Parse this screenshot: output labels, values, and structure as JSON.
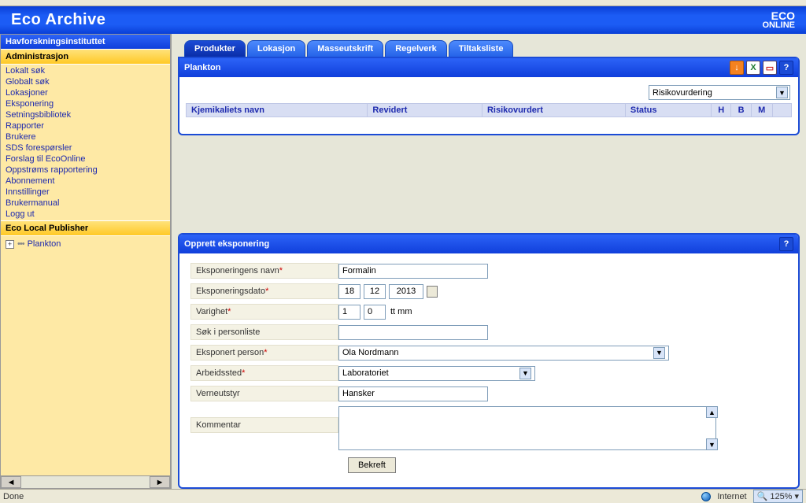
{
  "header": {
    "title": "Eco Archive",
    "logo_top": "ECO",
    "logo_bottom": "ONLINE"
  },
  "sidebar": {
    "org_header": "Havforskningsinstituttet",
    "section1_title": "Administrasjon",
    "links": [
      "Lokalt søk",
      "Globalt søk",
      "Lokasjoner",
      "Eksponering",
      "Setningsbibliotek",
      "Rapporter",
      "Brukere",
      "SDS forespørsler",
      "Forslag til EcoOnline",
      "Oppstrøms rapportering",
      "Abonnement",
      "Innstillinger",
      "Brukermanual",
      "Logg ut"
    ],
    "section2_title": "Eco Local Publisher",
    "tree_item": "Plankton"
  },
  "tabs": [
    "Produkter",
    "Lokasjon",
    "Masseutskrift",
    "Regelverk",
    "Tiltaksliste"
  ],
  "products": {
    "title": "Plankton",
    "filter_value": "Risikovurdering",
    "cols": {
      "name": "Kjemikaliets navn",
      "rev": "Revidert",
      "risk": "Risikovurdert",
      "status": "Status",
      "h": "H",
      "b": "B",
      "m": "M"
    }
  },
  "form": {
    "title": "Opprett eksponering",
    "labels": {
      "name": "Eksponeringens navn",
      "date": "Eksponeringsdato",
      "dur": "Varighet",
      "dur_unit": "tt mm",
      "search": "Søk i personliste",
      "person": "Eksponert person",
      "place": "Arbeidssted",
      "gear": "Verneutstyr",
      "comment": "Kommentar"
    },
    "values": {
      "name": "Formalin",
      "d": "18",
      "m": "12",
      "y": "2013",
      "dur_h": "1",
      "dur_m": "0",
      "search": "",
      "person": "Ola Nordmann",
      "place": "Laboratoriet",
      "gear": "Hansker",
      "comment": ""
    },
    "submit": "Bekreft"
  },
  "status": {
    "left": "Done",
    "zone": "Internet",
    "zoom": "125%"
  }
}
